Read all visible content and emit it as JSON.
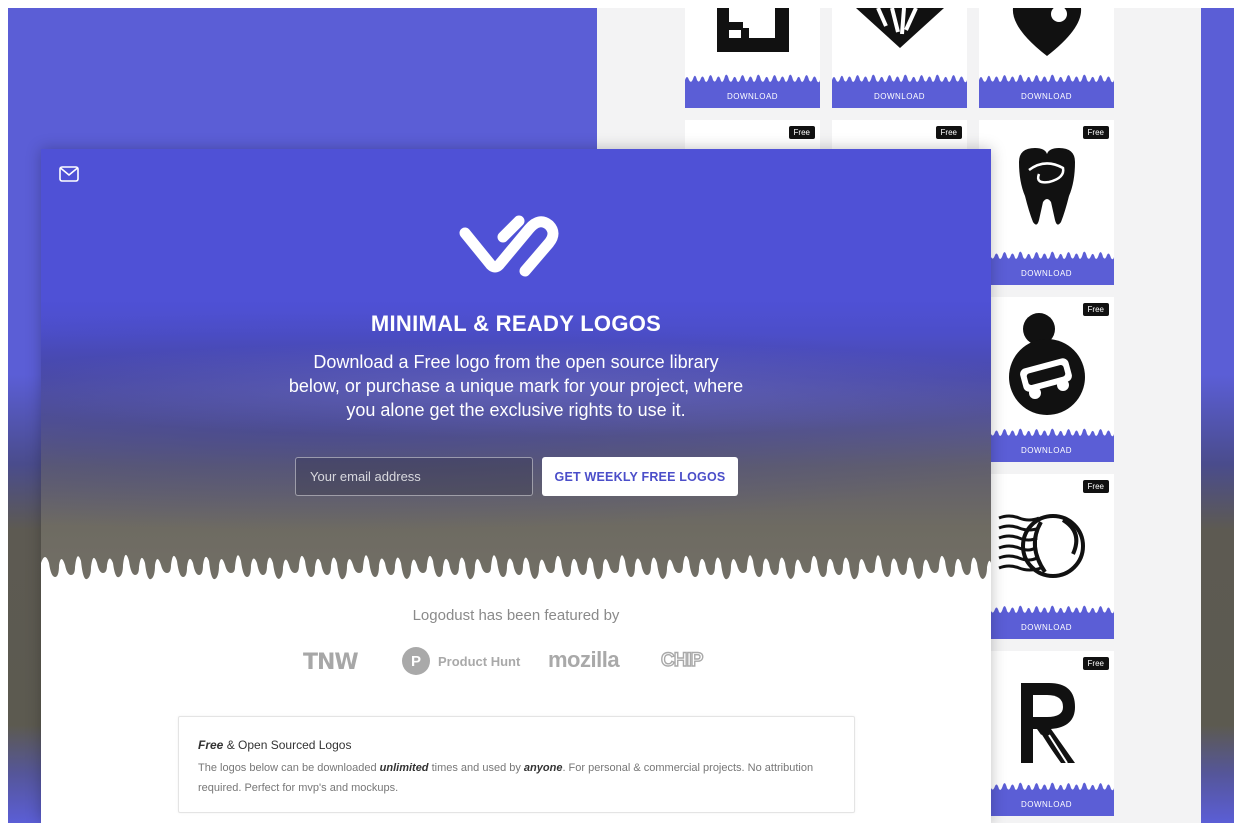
{
  "hero": {
    "title": "MINIMAL & READY LOGOS",
    "subtitle": "Download a Free logo from the open source library below, or purchase a unique mark for your project, where you alone get the exclusive rights to use it.",
    "email_placeholder": "Your email address",
    "cta_label": "GET WEEKLY FREE LOGOS"
  },
  "featured": {
    "title": "Logodust has been featured by",
    "press": [
      "TNW",
      "Product Hunt",
      "mozilla",
      "CHIP"
    ],
    "product_hunt_letter": "P"
  },
  "info_box": {
    "title_em": "Free",
    "title_rest": " & Open Sourced Logos",
    "body_pre": "The logos below can be downloaded ",
    "body_em1": "unlimited",
    "body_mid": " times and used by ",
    "body_em2": "anyone",
    "body_post": ". For personal & commercial projects. No attribution required. Perfect for mvp's and mockups."
  },
  "gallery": {
    "download_label": "DOWNLOAD",
    "free_badge": "Free"
  },
  "colors": {
    "brand_purple": "#5b5ed6",
    "hero_purple": "#4f51d6",
    "cta_text": "#4b4ec9"
  },
  "icons": [
    "mail-icon",
    "logodust-brand-mark"
  ]
}
